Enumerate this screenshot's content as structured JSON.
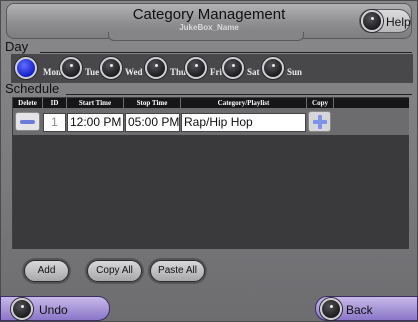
{
  "header": {
    "title": "Category Management",
    "subtitle": "JukeBox_Name",
    "help_label": "Help"
  },
  "day_section": {
    "label": "Day",
    "days": [
      {
        "label": "Mon",
        "selected": true
      },
      {
        "label": "Tue",
        "selected": false
      },
      {
        "label": "Wed",
        "selected": false
      },
      {
        "label": "Thu",
        "selected": false
      },
      {
        "label": "Fri",
        "selected": false
      },
      {
        "label": "Sat",
        "selected": false
      },
      {
        "label": "Sun",
        "selected": false
      }
    ]
  },
  "schedule": {
    "label": "Schedule",
    "columns": [
      "Delete",
      "ID",
      "Start Time",
      "Stop Time",
      "Category/Playlist",
      "Copy"
    ],
    "rows": [
      {
        "id": "1",
        "start": "12:00 PM",
        "stop": "05:00 PM",
        "category": "Rap/Hip Hop"
      }
    ]
  },
  "actions": {
    "add": "Add",
    "copy_all": "Copy All",
    "paste_all": "Paste All"
  },
  "footer": {
    "undo": "Undo",
    "back": "Back"
  },
  "colors": {
    "selected_knob": "#1420c8",
    "bottom_button": "#a896dc"
  }
}
